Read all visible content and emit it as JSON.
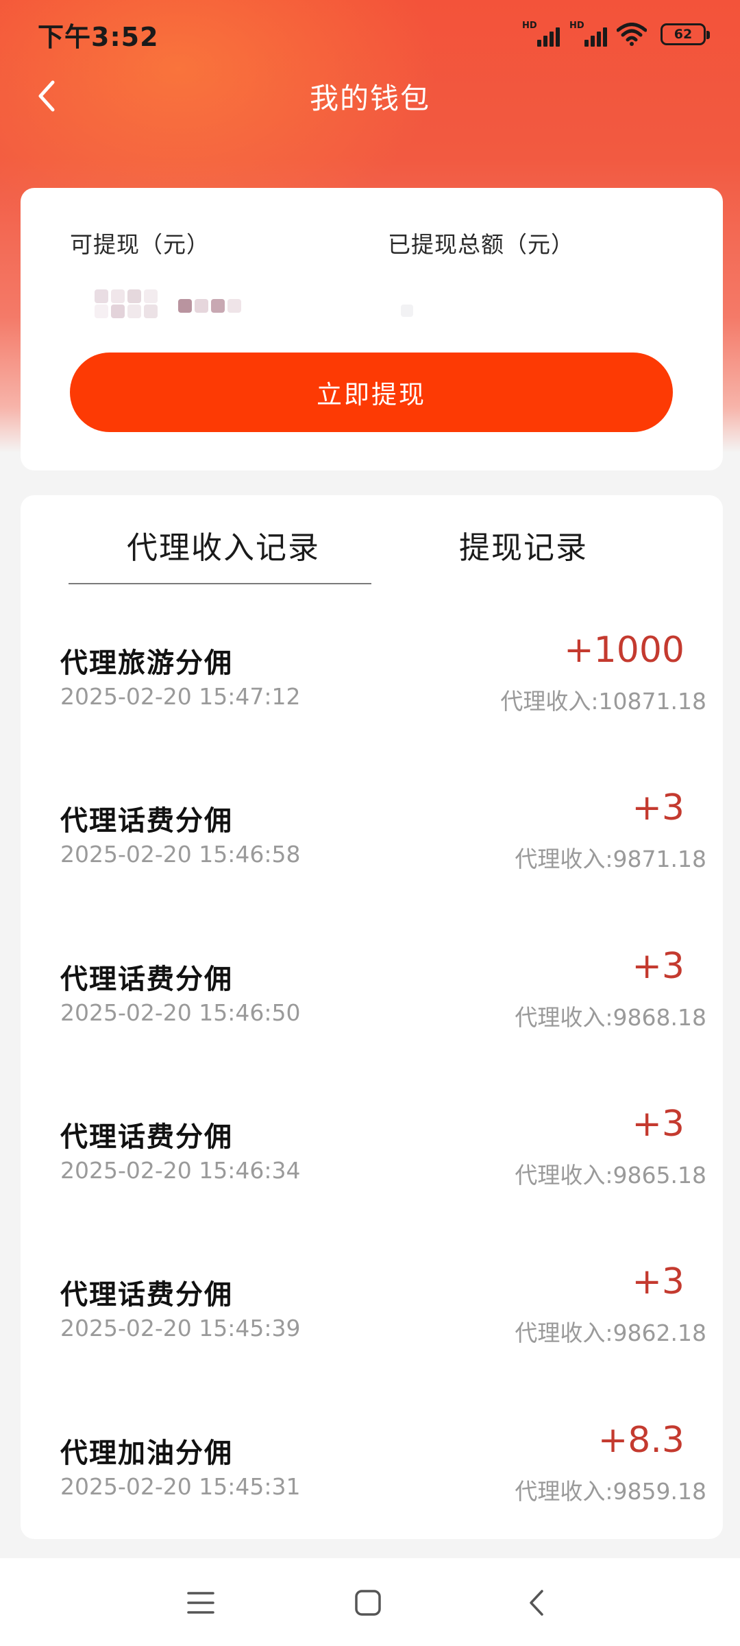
{
  "status_bar": {
    "time": "下午3:52",
    "battery_level": "62",
    "signal_tag": "HD"
  },
  "header": {
    "title": "我的钱包",
    "back_icon": "chevron-left-icon"
  },
  "wallet": {
    "withdrawable_label": "可提现（元）",
    "withdrawn_total_label": "已提现总额（元）",
    "withdraw_button_label": "立即提现"
  },
  "tabs": [
    {
      "label": "代理收入记录",
      "active": true
    },
    {
      "label": "提现记录",
      "active": false
    }
  ],
  "records": [
    {
      "title": "代理旅游分佣",
      "time": "2025-02-20 15:47:12",
      "amount": "+1000",
      "balance": "代理收入:10871.18"
    },
    {
      "title": "代理话费分佣",
      "time": "2025-02-20 15:46:58",
      "amount": "+3",
      "balance": "代理收入:9871.18"
    },
    {
      "title": "代理话费分佣",
      "time": "2025-02-20 15:46:50",
      "amount": "+3",
      "balance": "代理收入:9868.18"
    },
    {
      "title": "代理话费分佣",
      "time": "2025-02-20 15:46:34",
      "amount": "+3",
      "balance": "代理收入:9865.18"
    },
    {
      "title": "代理话费分佣",
      "time": "2025-02-20 15:45:39",
      "amount": "+3",
      "balance": "代理收入:9862.18"
    },
    {
      "title": "代理加油分佣",
      "time": "2025-02-20 15:45:31",
      "amount": "+8.3",
      "balance": "代理收入:9859.18"
    }
  ],
  "colors": {
    "accent": "#fd3a04",
    "amount": "#c43a2f",
    "header_gradient_top": "#f3533a"
  },
  "system_nav": {
    "menu_icon": "menu-icon",
    "home_icon": "home-square-icon",
    "back_icon": "back-triangle-icon"
  }
}
